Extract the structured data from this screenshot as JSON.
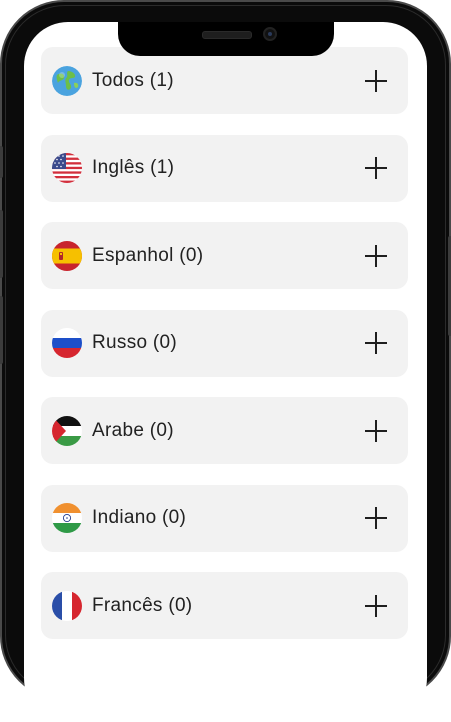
{
  "languages": [
    {
      "label": "Todos (1)",
      "flag": "globe-icon"
    },
    {
      "label": "Inglês (1)",
      "flag": "us-flag-icon"
    },
    {
      "label": "Espanhol (0)",
      "flag": "spain-flag-icon"
    },
    {
      "label": "Russo (0)",
      "flag": "russia-flag-icon"
    },
    {
      "label": "Arabe (0)",
      "flag": "palestine-flag-icon"
    },
    {
      "label": "Indiano (0)",
      "flag": "india-flag-icon"
    },
    {
      "label": "Francês (0)",
      "flag": "france-flag-icon"
    }
  ],
  "colors": {
    "row_background": "#f2f2f2",
    "text": "#222222",
    "frame": "#0b0b0b"
  }
}
